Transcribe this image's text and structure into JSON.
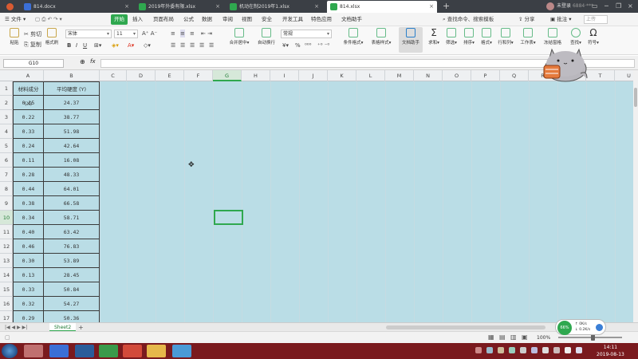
{
  "tabs": [
    {
      "label": "",
      "name": "home"
    },
    {
      "label": "814.docx"
    },
    {
      "label": "2019年外委有限.xlsx"
    },
    {
      "label": "机动在制2019年1.xlsx"
    },
    {
      "label": "814.xlsx"
    }
  ],
  "window": {
    "user": "未登录",
    "user_sub": "6884·***"
  },
  "menu": {
    "file": "文件",
    "items": [
      "开始",
      "插入",
      "页面布局",
      "公式",
      "数据",
      "审阅",
      "视图",
      "安全",
      "开发工具",
      "特色应用",
      "文档助手"
    ],
    "search": "查找命令、搜索模板",
    "share": "分享",
    "annotate": "批注",
    "find_placeholder": "上传"
  },
  "ribbon": {
    "cut": "剪切",
    "copy": "复制",
    "format_painter": "格式刷",
    "paste": "粘贴",
    "font_name": "宋体",
    "font_size": "11",
    "merge": "合并居中",
    "wrap": "自动换行",
    "number_format": "常规",
    "cond_format": "条件格式",
    "table_style": "表格样式",
    "doc_assist": "文档助手",
    "sum": "求和",
    "filter": "筛选",
    "sort": "排序",
    "format": "格式",
    "rowcol": "行和列",
    "sheet": "工作表",
    "freeze": "冻结窗格",
    "find": "查找",
    "symbol": "符号"
  },
  "formula": {
    "namebox": "G10",
    "fx": "fx",
    "value": ""
  },
  "columns": [
    "A",
    "B",
    "C",
    "D",
    "E",
    "F",
    "G",
    "H",
    "I",
    "J",
    "K",
    "L",
    "M",
    "N",
    "O",
    "P",
    "Q",
    "R",
    "S",
    "T",
    "U",
    "V"
  ],
  "rows": [
    "1",
    "2",
    "3",
    "4",
    "5",
    "6",
    "7",
    "8",
    "9",
    "10",
    "11",
    "12",
    "13",
    "14",
    "15",
    "16",
    "17"
  ],
  "headers": {
    "a": "材料成分 (X)",
    "b": "平均硬度 (Y)"
  },
  "table": [
    {
      "x": "0.15",
      "y": "24.37"
    },
    {
      "x": "0.22",
      "y": "38.77"
    },
    {
      "x": "0.33",
      "y": "51.98"
    },
    {
      "x": "0.24",
      "y": "42.64"
    },
    {
      "x": "0.11",
      "y": "16.08"
    },
    {
      "x": "0.28",
      "y": "48.33"
    },
    {
      "x": "0.44",
      "y": "64.01"
    },
    {
      "x": "0.38",
      "y": "66.58"
    },
    {
      "x": "0.34",
      "y": "58.71"
    },
    {
      "x": "0.40",
      "y": "63.42"
    },
    {
      "x": "0.46",
      "y": "76.83"
    },
    {
      "x": "0.30",
      "y": "53.89"
    },
    {
      "x": "0.13",
      "y": "28.45"
    },
    {
      "x": "0.33",
      "y": "50.84"
    },
    {
      "x": "0.32",
      "y": "54.27"
    },
    {
      "x": "0.29",
      "y": "50.36"
    }
  ],
  "sheet": {
    "name": "Sheet2",
    "add": "+"
  },
  "status": {
    "zoom": "100%"
  },
  "net": {
    "percent": "66%",
    "up": "0K/s",
    "down": "0.2K/s"
  },
  "clock": {
    "time": "14:11",
    "date": "2019-08-13"
  },
  "colors": {
    "accent": "#2fa84f",
    "grid_bg": "#badde6",
    "taskbar": "#7a1a1e"
  }
}
